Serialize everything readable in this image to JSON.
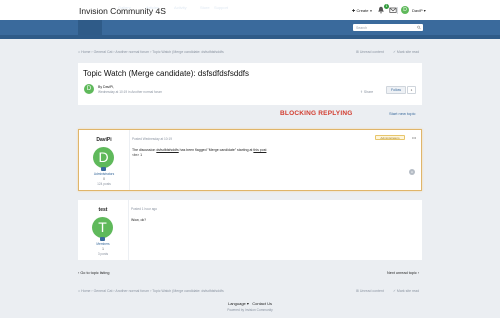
{
  "header": {
    "site_title": "Invision Community 4S",
    "create_label": "Create",
    "notif_count": "1",
    "user_initial": "D",
    "user_name": "DaviP"
  },
  "nav": {
    "items": [
      "Forums",
      "Gallery",
      "Articles",
      "Activity",
      "Store",
      "Support"
    ],
    "search_placeholder": "Search"
  },
  "breadcrumb": {
    "items": [
      "Home",
      "General Cat",
      "Another normal forum",
      "Topic Watch (Merge candidate: dsfsdfdsfsddfs"
    ],
    "unread": "Unread content",
    "mark_read": "Mark site read"
  },
  "topic": {
    "title": "Topic Watch (Merge candidate): dsfsdfdsfsddfs",
    "by": "By DaviPi,",
    "date": "Wednesday at 10:19 in Another normal forum",
    "share": "Share",
    "follow": "Follow",
    "follow_count": "1"
  },
  "notice": {
    "blocking": "BLOCKING REPLYING",
    "start_topic": "Start new topic"
  },
  "posts": [
    {
      "author": "DaviPi",
      "initial": "D",
      "group": "Administrators",
      "stat1": "0",
      "stat2": "124 posts",
      "posted": "Posted Wednesday at 10:19",
      "badge": "Administrators",
      "body_pre": "The discussion ",
      "body_link1": "dsfsdfdsfsddfs",
      "body_mid": " has been flagged \"Merge candidate\" starting at ",
      "body_link2": "this post",
      "body2": "<br> 1"
    },
    {
      "author": "test",
      "initial": "T",
      "group": "Members",
      "stat1": "1",
      "stat2": "3 posts",
      "posted": "Posted 1 hour ago",
      "body2": "Wow, ok?"
    }
  ],
  "pager": {
    "prev": "Go to topic listing",
    "next": "Next unread topic"
  },
  "footer": {
    "language": "Language",
    "contact": "Contact Us",
    "powered": "Powered by Invision Community"
  }
}
